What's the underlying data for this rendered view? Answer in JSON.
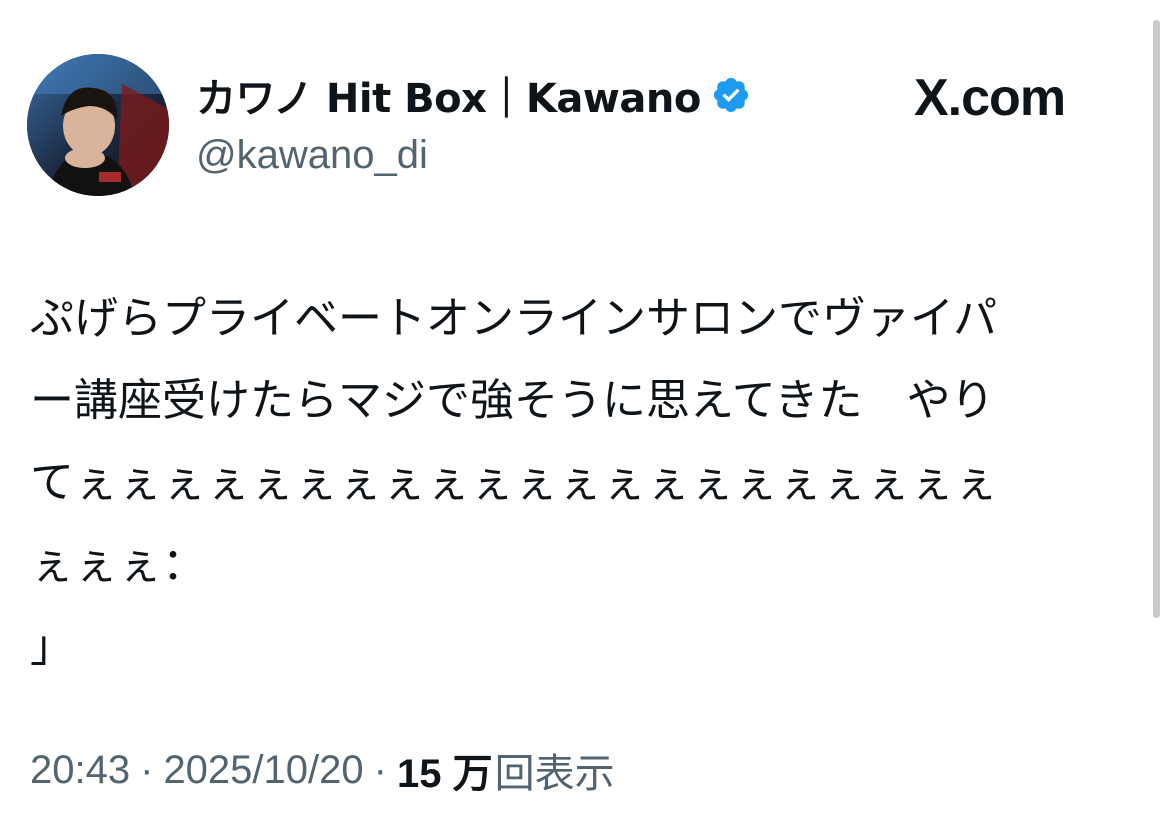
{
  "user": {
    "display_name": "カワノ Hit Box｜Kawano",
    "handle": "@kawano_di",
    "verified": true,
    "verified_color": "#1d9bf0",
    "avatar_icon": "profile-photo"
  },
  "brand": {
    "domain": "X.com",
    "logo_icon": "x-logo-icon"
  },
  "tweet": {
    "lines": [
      "ぷげらプライベートオンラインサロンでヴァイパ",
      "ー講座受けたらマジで強そうに思えてきた　やり",
      "てぇぇぇぇぇぇぇぇぇぇぇぇぇぇぇぇぇぇぇぇぇ",
      "ぇぇぇ：",
      "」"
    ]
  },
  "meta": {
    "time": "20:43",
    "separator": "·",
    "date": "2025/10/20",
    "views_count": "15 万",
    "views_label": "回表示"
  },
  "colors": {
    "text_primary": "#0f1419",
    "text_secondary": "#536471",
    "accent": "#1d9bf0"
  }
}
